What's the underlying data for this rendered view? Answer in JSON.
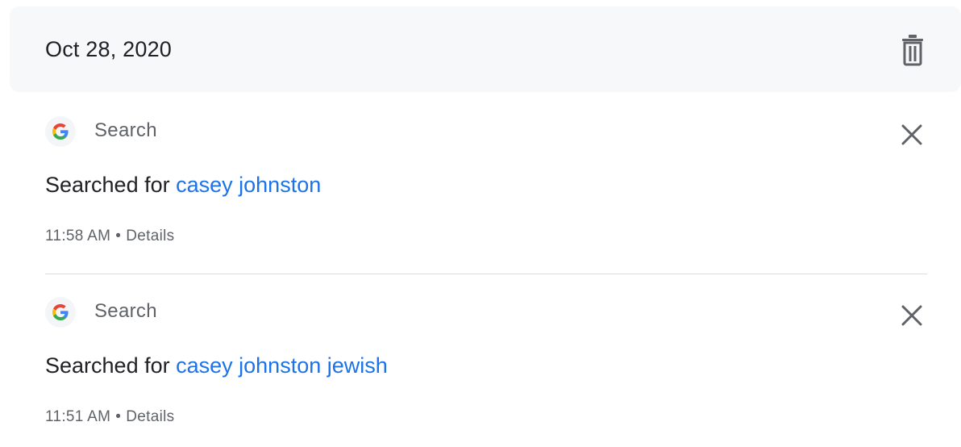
{
  "date_header": {
    "date": "Oct 28, 2020"
  },
  "icons": {
    "delete": "trash-icon",
    "remove_item": "close-icon",
    "product": "google-g-icon"
  },
  "entries": [
    {
      "product": "Search",
      "action_prefix": "Searched for",
      "query": "casey johnston",
      "time": "11:58 AM",
      "separator": "•",
      "details_label": "Details"
    },
    {
      "product": "Search",
      "action_prefix": "Searched for",
      "query": "casey johnston jewish",
      "time": "11:51 AM",
      "separator": "•",
      "details_label": "Details"
    }
  ],
  "colors": {
    "link": "#1a73e8",
    "header_bg": "#f7f8fa",
    "secondary_text": "#5f6368",
    "primary_text": "#202124",
    "google_blue": "#4285F4",
    "google_red": "#EA4335",
    "google_yellow": "#FBBC05",
    "google_green": "#34A853"
  }
}
